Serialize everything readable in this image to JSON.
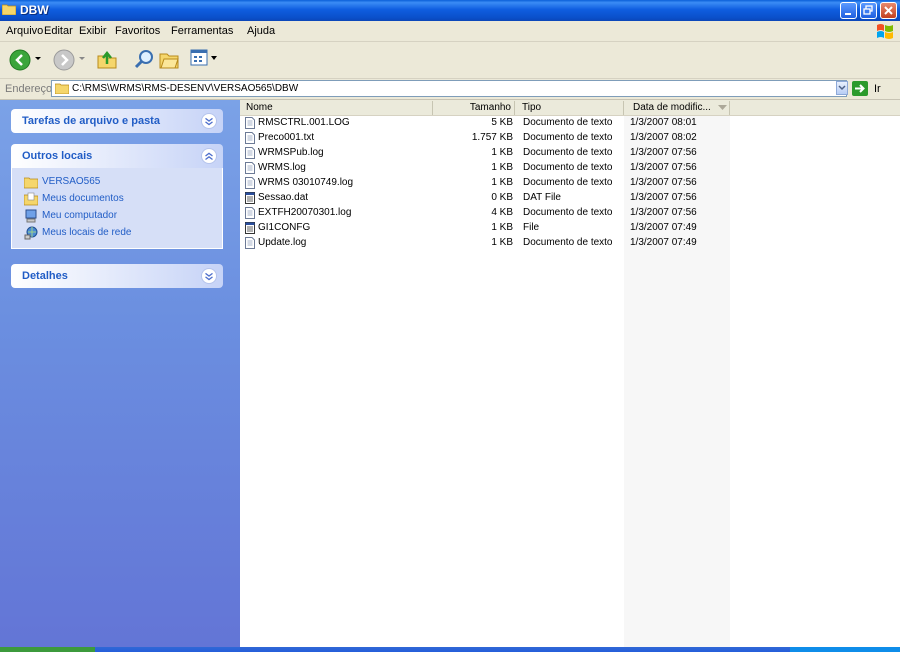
{
  "window": {
    "title": "DBW"
  },
  "menu": [
    "Arquivo",
    "Editar",
    "Exibir",
    "Favoritos",
    "Ferramentas",
    "Ajuda"
  ],
  "address": {
    "label": "Endereço",
    "path": "C:\\RMS\\WRMS\\RMS-DESENV\\VERSAO565\\DBW",
    "go_label": "Ir"
  },
  "sidebar": {
    "tasks_title": "Tarefas de arquivo e pasta",
    "places_title": "Outros locais",
    "places": [
      "VERSAO565",
      "Meus documentos",
      "Meu computador",
      "Meus locais de rede"
    ],
    "details_title": "Detalhes"
  },
  "columns": {
    "name": "Nome",
    "size": "Tamanho",
    "type": "Tipo",
    "date": "Data de modific..."
  },
  "files": [
    {
      "icon": "text-file-icon",
      "name": "RMSCTRL.001.LOG",
      "size": "5 KB",
      "type": "Documento de texto",
      "date": "1/3/2007 08:01"
    },
    {
      "icon": "text-file-icon",
      "name": "Preco001.txt",
      "size": "1.757 KB",
      "type": "Documento de texto",
      "date": "1/3/2007 08:02"
    },
    {
      "icon": "text-file-icon",
      "name": "WRMSPub.log",
      "size": "1 KB",
      "type": "Documento de texto",
      "date": "1/3/2007 07:56"
    },
    {
      "icon": "text-file-icon",
      "name": "WRMS.log",
      "size": "1 KB",
      "type": "Documento de texto",
      "date": "1/3/2007 07:56"
    },
    {
      "icon": "text-file-icon",
      "name": "WRMS 03010749.log",
      "size": "1 KB",
      "type": "Documento de texto",
      "date": "1/3/2007 07:56"
    },
    {
      "icon": "generic-file-icon",
      "name": "Sessao.dat",
      "size": "0 KB",
      "type": "DAT File",
      "date": "1/3/2007 07:56"
    },
    {
      "icon": "text-file-icon",
      "name": "EXTFH20070301.log",
      "size": "4 KB",
      "type": "Documento de texto",
      "date": "1/3/2007 07:56"
    },
    {
      "icon": "generic-file-icon",
      "name": "GI1CONFG",
      "size": "1 KB",
      "type": "File",
      "date": "1/3/2007 07:49"
    },
    {
      "icon": "text-file-icon",
      "name": "Update.log",
      "size": "1 KB",
      "type": "Documento de texto",
      "date": "1/3/2007 07:49"
    }
  ],
  "colors": {
    "title_blue": "#0a4fc9",
    "sidebar_blue": "#6b8fe0",
    "link_blue": "#215dc6"
  }
}
